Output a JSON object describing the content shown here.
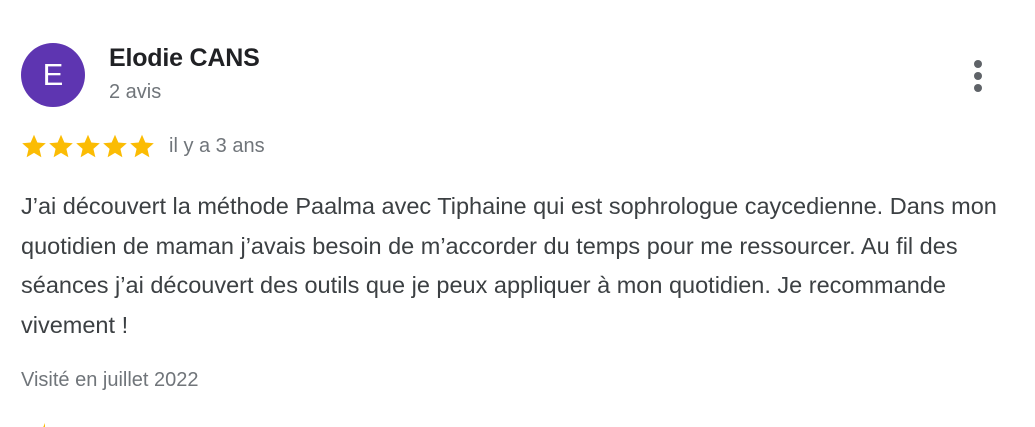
{
  "author": {
    "avatar_letter": "E",
    "avatar_color": "#5e35b1",
    "name": "Elodie CANS",
    "review_count": "2 avis"
  },
  "review": {
    "rating": 5,
    "rating_max": 5,
    "star_color": "#fbbc04",
    "date": "il y a 3 ans",
    "text": "J’ai découvert la méthode Paalma avec Tiphaine qui est sophrologue caycedienne. Dans mon quotidien de maman j’avais besoin de m’accorder du temps pour me ressourcer. Au fil des séances j’ai découvert des outils que je peux appliquer à mon quotidien. Je recommande vivement !",
    "visit": "Visité en juillet 2022"
  },
  "icons": {
    "more": "more-vert-icon",
    "star": "star-icon"
  }
}
